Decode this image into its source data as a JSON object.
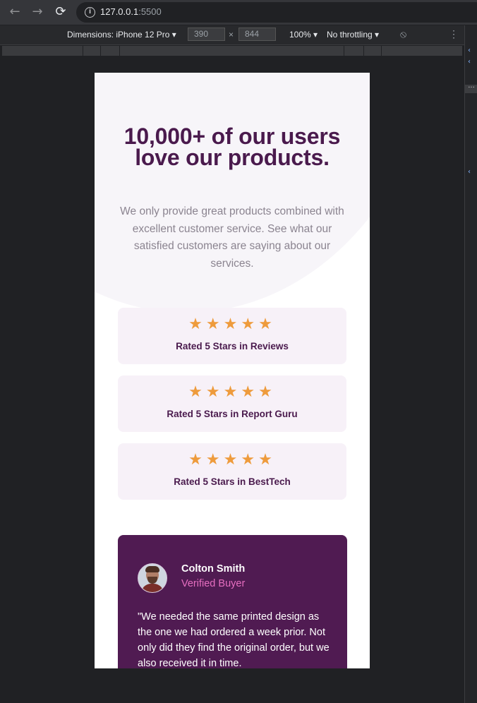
{
  "browser": {
    "url_host": "127.0.0.1",
    "url_port": ":5500"
  },
  "devtools": {
    "dimensions_label": "Dimensions: iPhone 12 Pro",
    "width": "390",
    "times": "×",
    "height": "844",
    "zoom": "100%",
    "throttling": "No throttling"
  },
  "page": {
    "heading": "10,000+ of our users love our products.",
    "intro": "We only provide great products combined with excellent customer service. See what our satisfied customers are saying about our services.",
    "ratings": [
      {
        "stars": 5,
        "label": "Rated 5 Stars in Reviews"
      },
      {
        "stars": 5,
        "label": "Rated 5 Stars in Report Guru"
      },
      {
        "stars": 5,
        "label": "Rated 5 Stars in BestTech"
      }
    ],
    "testimonial": {
      "name": "Colton Smith",
      "role": "Verified Buyer",
      "quote": "\"We needed the same printed design as the one we had ordered a week prior. Not only did they find the original order, but we also received it in time."
    }
  },
  "colors": {
    "heading": "#4a1a4d",
    "star": "#ee9b3c",
    "card_bg": "#f7f1f8",
    "testimonial_bg": "#501b52",
    "accent_pink": "#e66ec0"
  }
}
